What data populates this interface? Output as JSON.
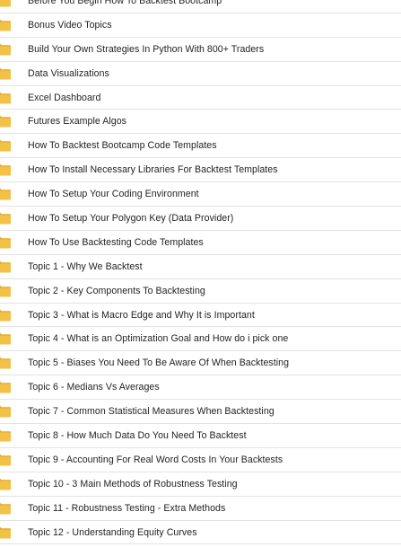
{
  "file_list": {
    "icon": "folder-icon",
    "icon_color": "#f2c146",
    "items": [
      {
        "label": "Before You Begin How To Backtest Bootcamp"
      },
      {
        "label": "Bonus Video Topics"
      },
      {
        "label": "Build Your Own Strategies In Python With 800+ Traders"
      },
      {
        "label": "Data Visualizations"
      },
      {
        "label": "Excel Dashboard"
      },
      {
        "label": "Futures Example Algos"
      },
      {
        "label": "How To Backtest Bootcamp Code Templates"
      },
      {
        "label": "How To Install Necessary Libraries For Backtest Templates"
      },
      {
        "label": "How To Setup Your Coding Environment"
      },
      {
        "label": "How To Setup Your Polygon Key (Data Provider)"
      },
      {
        "label": "How To Use Backtesting Code Templates"
      },
      {
        "label": "Topic 1 - Why We Backtest"
      },
      {
        "label": "Topic 2 - Key Components To Backtesting"
      },
      {
        "label": "Topic 3 - What is Macro Edge and Why It is Important"
      },
      {
        "label": "Topic 4 - What is an Optimization Goal and How do i pick one"
      },
      {
        "label": "Topic 5 - Biases You Need To Be Aware Of When Backtesting"
      },
      {
        "label": "Topic 6 - Medians Vs Averages"
      },
      {
        "label": "Topic 7 - Common Statistical Measures When Backtesting"
      },
      {
        "label": "Topic 8 - How Much Data Do You Need To Backtest"
      },
      {
        "label": "Topic 9 - Accounting For Real Word Costs In Your Backtests"
      },
      {
        "label": "Topic 10 - 3 Main Methods of Robustness Testing"
      },
      {
        "label": "Topic 11 - Robustness Testing - Extra Methods"
      },
      {
        "label": "Topic 12 - Understanding Equity Curves"
      }
    ]
  }
}
